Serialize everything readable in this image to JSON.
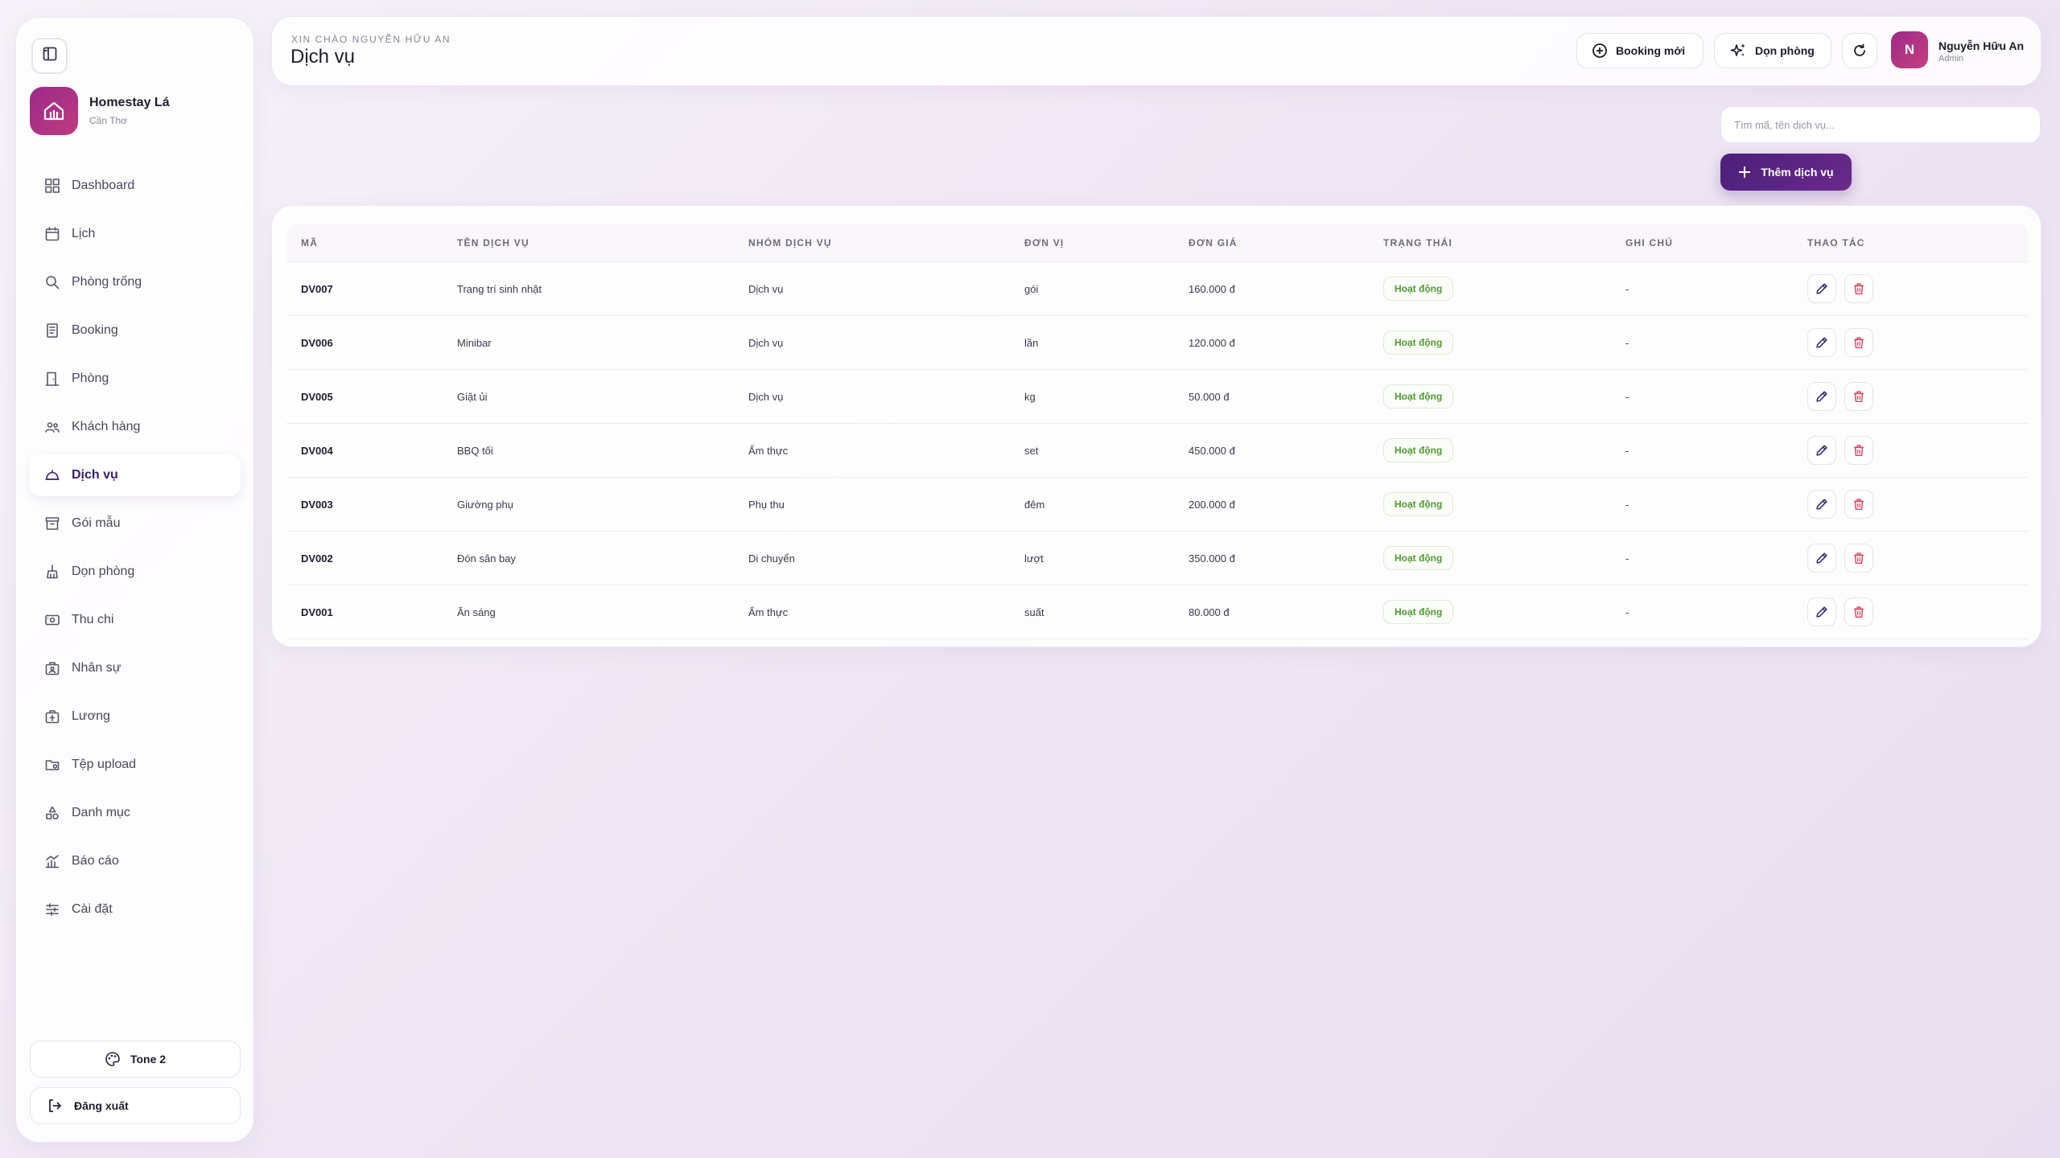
{
  "sidebar": {
    "brand": {
      "name": "Homestay Lá",
      "location": "Cần Thơ"
    },
    "items": [
      {
        "label": "Dashboard",
        "icon": "dashboard-icon"
      },
      {
        "label": "Lịch",
        "icon": "calendar-icon"
      },
      {
        "label": "Phòng trống",
        "icon": "search-icon"
      },
      {
        "label": "Booking",
        "icon": "receipt-icon"
      },
      {
        "label": "Phòng",
        "icon": "door-icon"
      },
      {
        "label": "Khách hàng",
        "icon": "users-icon"
      },
      {
        "label": "Dịch vụ",
        "icon": "service-bell-icon",
        "active": true
      },
      {
        "label": "Gói mẫu",
        "icon": "package-icon"
      },
      {
        "label": "Dọn phòng",
        "icon": "broom-icon"
      },
      {
        "label": "Thu chi",
        "icon": "money-icon"
      },
      {
        "label": "Nhân sự",
        "icon": "staff-icon"
      },
      {
        "label": "Lương",
        "icon": "salary-icon"
      },
      {
        "label": "Tệp upload",
        "icon": "folder-icon"
      },
      {
        "label": "Danh mục",
        "icon": "shapes-icon"
      },
      {
        "label": "Báo cáo",
        "icon": "chart-icon"
      },
      {
        "label": "Cài đặt",
        "icon": "sliders-icon"
      }
    ],
    "tone_label": "Tone 2",
    "logout_label": "Đăng xuất"
  },
  "header": {
    "greeting": "XIN CHÀO NGUYỄN HỮU AN",
    "title": "Dịch vụ",
    "booking_label": "Booking mới",
    "clean_label": "Dọn phòng",
    "user": {
      "initial": "N",
      "name": "Nguyễn Hữu An",
      "role": "Admin"
    }
  },
  "search": {
    "placeholder": "Tìm mã, tên dịch vụ...",
    "value": ""
  },
  "add_button_label": "Thêm dịch vụ",
  "table": {
    "columns": [
      "MÃ",
      "TÊN DỊCH VỤ",
      "NHÓM DỊCH VỤ",
      "ĐƠN VỊ",
      "ĐƠN GIÁ",
      "TRẠNG THÁI",
      "GHI CHÚ",
      "THAO TÁC"
    ],
    "rows": [
      {
        "code": "DV007",
        "name": "Trang trí sinh nhật",
        "group": "Dịch vụ",
        "unit": "gói",
        "price": "160.000 đ",
        "status": "Hoạt động",
        "note": "-"
      },
      {
        "code": "DV006",
        "name": "Minibar",
        "group": "Dịch vụ",
        "unit": "lần",
        "price": "120.000 đ",
        "status": "Hoạt động",
        "note": "-"
      },
      {
        "code": "DV005",
        "name": "Giặt ủi",
        "group": "Dịch vụ",
        "unit": "kg",
        "price": "50.000 đ",
        "status": "Hoạt động",
        "note": "-"
      },
      {
        "code": "DV004",
        "name": "BBQ tối",
        "group": "Ẩm thực",
        "unit": "set",
        "price": "450.000 đ",
        "status": "Hoạt động",
        "note": "-"
      },
      {
        "code": "DV003",
        "name": "Giường phụ",
        "group": "Phụ thu",
        "unit": "đêm",
        "price": "200.000 đ",
        "status": "Hoạt động",
        "note": "-"
      },
      {
        "code": "DV002",
        "name": "Đón sân bay",
        "group": "Di chuyển",
        "unit": "lượt",
        "price": "350.000 đ",
        "status": "Hoạt động",
        "note": "-"
      },
      {
        "code": "DV001",
        "name": "Ăn sáng",
        "group": "Ẩm thực",
        "unit": "suất",
        "price": "80.000 đ",
        "status": "Hoạt động",
        "note": "-"
      }
    ]
  },
  "colors": {
    "accent": "#4b1f7a",
    "brand": "#9b2a8a",
    "status_active": "#4e9a2e",
    "delete": "#d9445f"
  }
}
